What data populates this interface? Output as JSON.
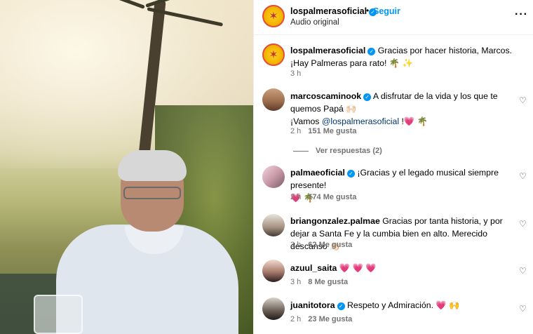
{
  "post": {
    "username": "lospalmerasoficial",
    "follow_label": "Seguir",
    "audio_label": "Audio original",
    "more_icon": "more-horizontal-icon"
  },
  "caption": {
    "username": "lospalmerasoficial",
    "text": "Gracias por hacer historia, Marcos. ¡Hay Palmeras para rato! 🌴 ✨",
    "time": "3 h"
  },
  "comments": [
    {
      "username": "marcoscaminook",
      "verified": true,
      "text_line1": "A disfrutar de la vida y los que te quemos Papá 🙌🏻",
      "text_line2_prefix": "¡Vamos ",
      "mention": "@lospalmerasoficial",
      "text_line2_suffix": " !💗 🌴",
      "time": "2 h",
      "likes": "151 Me gusta",
      "view_replies": "Ver respuestas (2)"
    },
    {
      "username": "palmaeoficial",
      "verified": true,
      "text": "¡Gracias y el legado musical siempre presente!",
      "text_line2": "💗 🌴",
      "time": "2 h",
      "likes": "174 Me gusta"
    },
    {
      "username": "briangonzalez.palmae",
      "verified": false,
      "text": "Gracias por tanta historia, y por dejar a Santa Fe y la cumbia bien en alto. Merecido descanso 👏🏻",
      "time": "3 h",
      "likes": "62 Me gusta"
    },
    {
      "username": "azuul_saita",
      "verified": false,
      "text": "💗 💗 💗",
      "time": "3 h",
      "likes": "8 Me gusta"
    },
    {
      "username": "juanitotora",
      "verified": true,
      "text": "Respeto y Admiración. 💗 🙌",
      "time": "2 h",
      "likes": "23 Me gusta"
    }
  ],
  "icons": {
    "like": "heart-outline-icon",
    "verified": "verified-badge-icon"
  },
  "colors": {
    "link_blue": "#0095f6",
    "mention": "#00376b",
    "meta_gray": "#737373",
    "verified": "#0095f6"
  }
}
